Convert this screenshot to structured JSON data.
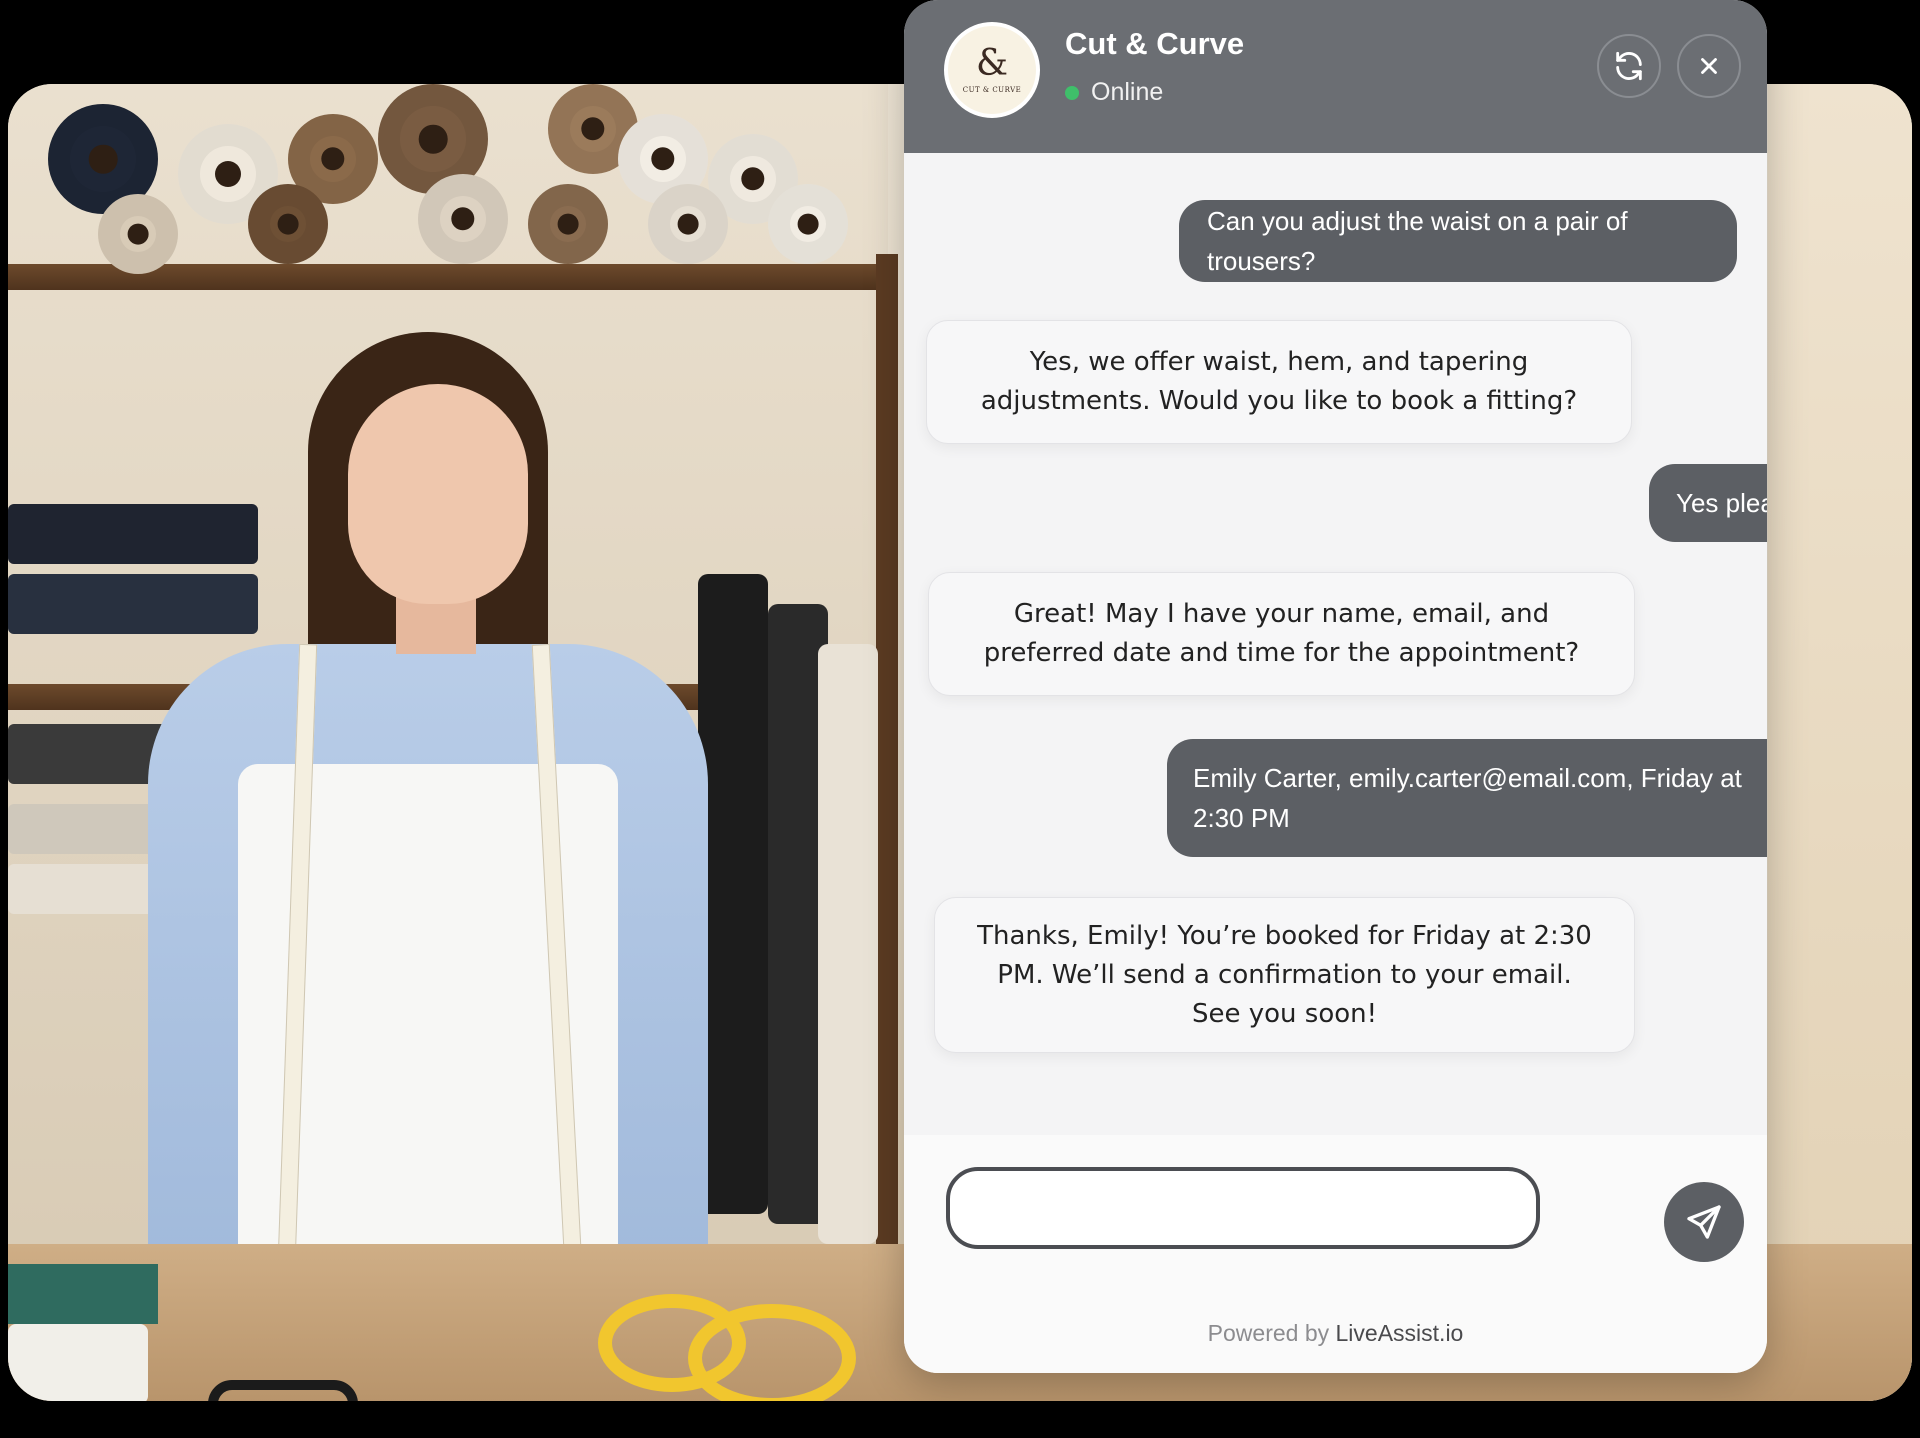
{
  "widget": {
    "brand_name": "Cut & Curve",
    "logo_text": "CUT & CURVE",
    "logo_symbol": "&",
    "status": "Online",
    "status_color": "#3fbf6a",
    "refresh_icon": "refresh-icon",
    "close_icon": "close-icon",
    "header_color": "#6b6e73"
  },
  "messages": [
    {
      "from": "user",
      "text": "Can you adjust the waist on a pair of trousers?"
    },
    {
      "from": "bot",
      "lines": [
        "Yes, we offer waist, hem, and tapering",
        "adjustments. Would you like to book a fitting?"
      ]
    },
    {
      "from": "user",
      "text": "Yes please"
    },
    {
      "from": "bot",
      "lines": [
        "Great! May I have your name, email, and",
        "preferred date and time for the appointment?"
      ]
    },
    {
      "from": "user",
      "lines": [
        "Emily Carter, emily.carter@email.com, Friday at",
        "2:30 PM"
      ]
    },
    {
      "from": "bot",
      "lines": [
        "Thanks, Emily! You’re booked for Friday at 2:30",
        "PM. We’ll send a confirmation to your email.",
        "See you soon!"
      ]
    }
  ],
  "composer": {
    "placeholder": "",
    "value": "",
    "send_icon": "send-icon"
  },
  "footer": {
    "powered_prefix": "Powered by",
    "powered_brand": "LiveAssist.io"
  }
}
